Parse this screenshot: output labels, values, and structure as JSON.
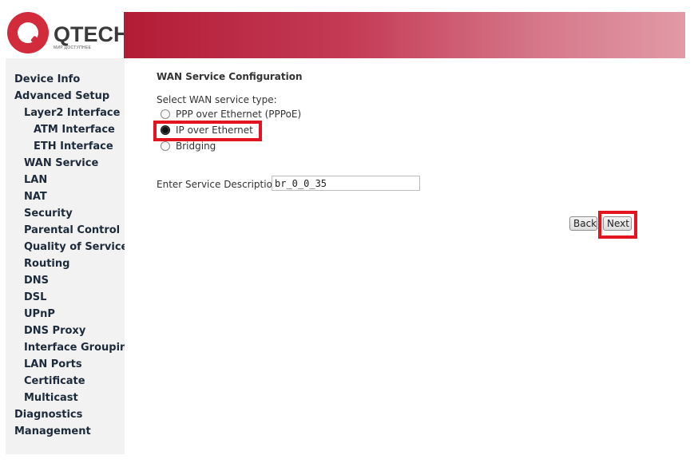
{
  "brand": {
    "name": "QTECH",
    "tagline": "МИР ДОСТУПНЕЕ",
    "primary_color": "#d12b3c",
    "banner_color": "#b31c35"
  },
  "sidebar": {
    "items": [
      {
        "label": "Device Info",
        "level": 0
      },
      {
        "label": "Advanced Setup",
        "level": 0
      },
      {
        "label": "Layer2 Interface",
        "level": 1
      },
      {
        "label": "ATM Interface",
        "level": 2
      },
      {
        "label": "ETH Interface",
        "level": 2
      },
      {
        "label": "WAN Service",
        "level": 1
      },
      {
        "label": "LAN",
        "level": 1
      },
      {
        "label": "NAT",
        "level": 1
      },
      {
        "label": "Security",
        "level": 1
      },
      {
        "label": "Parental Control",
        "level": 1
      },
      {
        "label": "Quality of Service",
        "level": 1
      },
      {
        "label": "Routing",
        "level": 1
      },
      {
        "label": "DNS",
        "level": 1
      },
      {
        "label": "DSL",
        "level": 1
      },
      {
        "label": "UPnP",
        "level": 1
      },
      {
        "label": "DNS Proxy",
        "level": 1
      },
      {
        "label": "Interface Grouping",
        "level": 1
      },
      {
        "label": "LAN Ports",
        "level": 1
      },
      {
        "label": "Certificate",
        "level": 1
      },
      {
        "label": "Multicast",
        "level": 1
      },
      {
        "label": "Diagnostics",
        "level": 0
      },
      {
        "label": "Management",
        "level": 0
      }
    ]
  },
  "main": {
    "title": "WAN Service Configuration",
    "service_type_label": "Select WAN service type:",
    "options": [
      {
        "label": "PPP over Ethernet (PPPoE)",
        "selected": false
      },
      {
        "label": "IP over Ethernet",
        "selected": true
      },
      {
        "label": "Bridging",
        "selected": false
      }
    ],
    "description_label": "Enter Service Description:",
    "description_value": "br_0_0_35",
    "back_label": "Back",
    "next_label": "Next"
  }
}
